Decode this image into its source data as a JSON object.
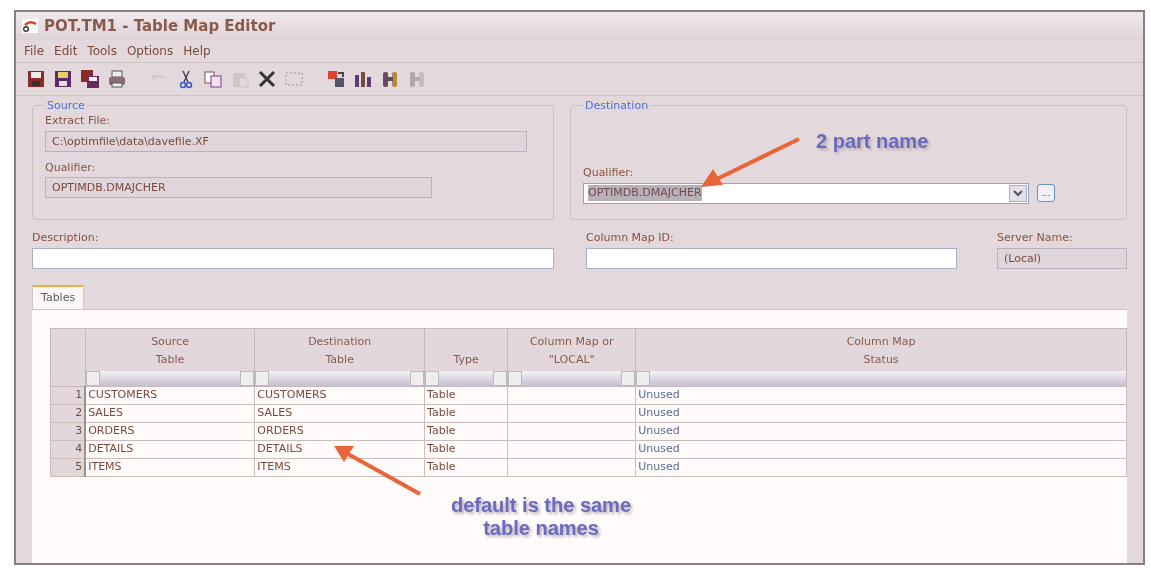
{
  "window": {
    "title": "POT.TM1 - Table Map Editor"
  },
  "menu": [
    "File",
    "Edit",
    "Tools",
    "Options",
    "Help"
  ],
  "toolbar": [
    {
      "kind": "save",
      "disabled": false
    },
    {
      "kind": "save-as",
      "disabled": false
    },
    {
      "kind": "save-all",
      "disabled": false
    },
    {
      "kind": "print",
      "disabled": false
    },
    {
      "kind": "gap"
    },
    {
      "kind": "undo",
      "disabled": true
    },
    {
      "kind": "cut",
      "disabled": false
    },
    {
      "kind": "copy",
      "disabled": false
    },
    {
      "kind": "paste",
      "disabled": true
    },
    {
      "kind": "delete",
      "disabled": false
    },
    {
      "kind": "select",
      "disabled": true
    },
    {
      "kind": "gap"
    },
    {
      "kind": "map",
      "disabled": false
    },
    {
      "kind": "columns",
      "disabled": false
    },
    {
      "kind": "find",
      "disabled": false
    },
    {
      "kind": "find",
      "disabled": true
    }
  ],
  "source": {
    "legend": "Source",
    "extract_label": "Extract File:",
    "extract_value": "C:\\optimfile\\data\\davefile.XF",
    "qualifier_label": "Qualifier:",
    "qualifier_value": "OPTIMDB.DMAJCHER"
  },
  "destination": {
    "legend": "Destination",
    "qualifier_label": "Qualifier:",
    "qualifier_value": "OPTIMDB.DMAJCHER",
    "browse": "..."
  },
  "description": {
    "label": "Description:"
  },
  "column_map_id": {
    "label": "Column Map ID:"
  },
  "server_name": {
    "label": "Server Name:",
    "value": "(Local)"
  },
  "tabs": [
    {
      "label": "Tables",
      "selected": true
    }
  ],
  "table": {
    "columns": [
      "Source\nTable",
      "Destination\nTable",
      "Type",
      "Column Map or\n\"LOCAL\"",
      "Column Map\nStatus"
    ],
    "rows": [
      {
        "number": "1",
        "cells": [
          "CUSTOMERS",
          "CUSTOMERS",
          "Table",
          "",
          "Unused"
        ]
      },
      {
        "number": "2",
        "cells": [
          "SALES",
          "SALES",
          "Table",
          "",
          "Unused"
        ]
      },
      {
        "number": "3",
        "cells": [
          "ORDERS",
          "ORDERS",
          "Table",
          "",
          "Unused"
        ]
      },
      {
        "number": "4",
        "cells": [
          "DETAILS",
          "DETAILS",
          "Table",
          "",
          "Unused"
        ]
      },
      {
        "number": "5",
        "cells": [
          "ITEMS",
          "ITEMS",
          "Table",
          "",
          "Unused"
        ]
      }
    ]
  },
  "annotations": [
    {
      "text": "2 part name"
    },
    {
      "text": "default is the same table names"
    }
  ]
}
